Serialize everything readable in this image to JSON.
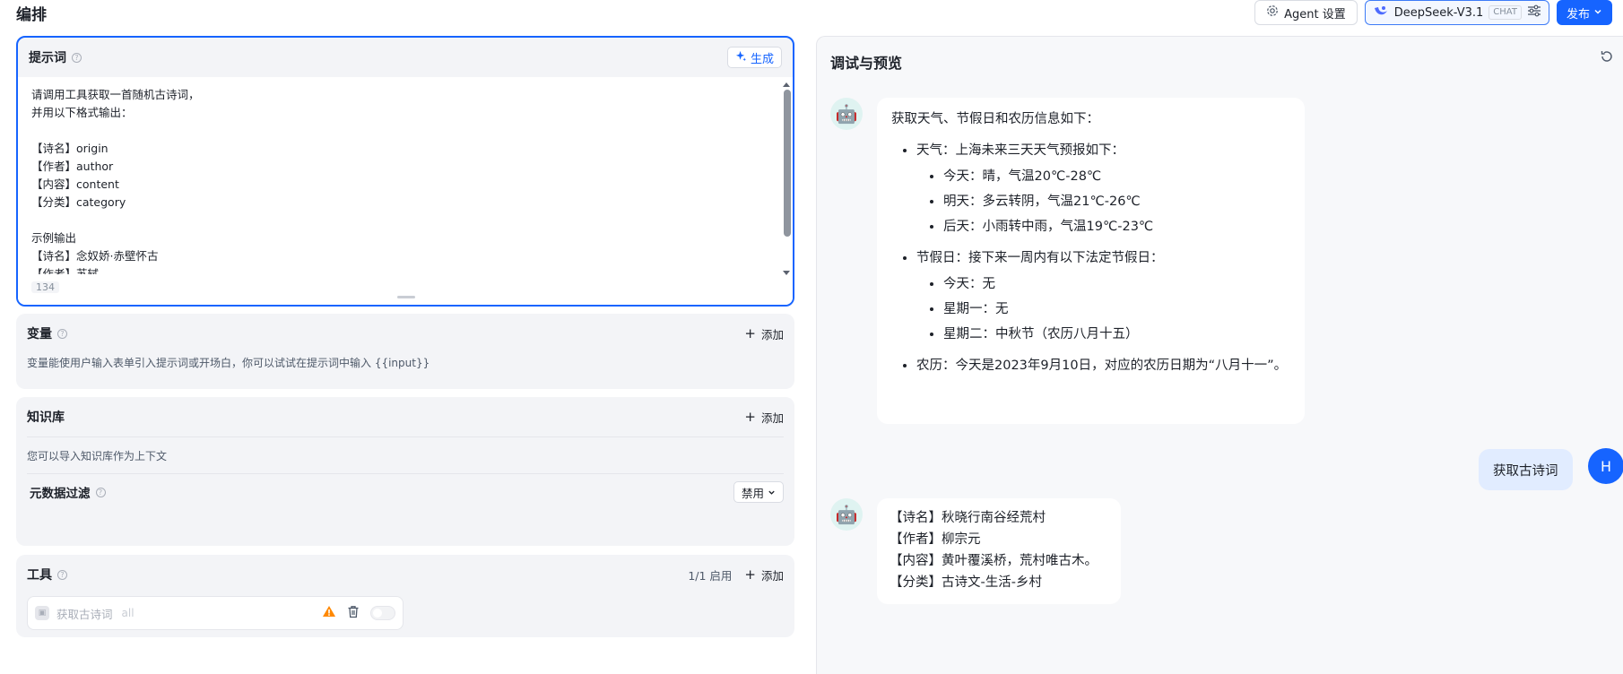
{
  "header": {
    "title": "编排",
    "agent_settings_label": "Agent 设置",
    "model_name": "DeepSeek-V3.1",
    "model_tag": "CHAT",
    "publish_label": "发布"
  },
  "prompt": {
    "title": "提示词",
    "generate_label": "生成",
    "text": "请调用工具获取一首随机古诗词，\n并用以下格式输出：\n\n【诗名】origin\n【作者】author\n【内容】content\n【分类】category\n\n示例输出\n【诗名】念奴娇·赤壁怀古\n【作者】苏轼",
    "char_count": "134"
  },
  "variables": {
    "title": "变量",
    "add_label": "添加",
    "description": "变量能使用户输入表单引入提示词或开场白，你可以试试在提示词中输入 {{input}}"
  },
  "knowledge": {
    "title": "知识库",
    "add_label": "添加",
    "description": "您可以导入知识库作为上下文",
    "metadata_filter_label": "元数据过滤",
    "metadata_filter_value": "禁用"
  },
  "tools": {
    "title": "工具",
    "status": "1/1 启用",
    "add_label": "添加",
    "items": [
      {
        "name": "获取古诗词",
        "sub": "all"
      }
    ]
  },
  "preview": {
    "title": "调试与预览",
    "messages": [
      {
        "role": "assistant",
        "intro": "获取天气、节假日和农历信息如下：",
        "weather_label": "天气：上海未来三天天气预报如下：",
        "weather": [
          "今天：晴，气温20℃-28℃",
          "明天：多云转阴，气温21℃-26℃",
          "后天：小雨转中雨，气温19℃-23℃"
        ],
        "holiday_label": "节假日：接下来一周内有以下法定节假日：",
        "holidays": [
          "今天：无",
          "星期一：无",
          "星期二：中秋节（农历八月十五）"
        ],
        "lunar": "农历：今天是2023年9月10日，对应的农历日期为“八月十一”。"
      },
      {
        "role": "user",
        "text": "获取古诗词",
        "avatar_letter": "H"
      },
      {
        "role": "assistant",
        "lines": [
          "【诗名】秋晓行南谷经荒村",
          "【作者】柳宗元",
          "【内容】黄叶覆溪桥，荒村唯古木。",
          "【分类】古诗文-生活-乡村"
        ]
      }
    ]
  },
  "colors": {
    "primary": "#1664ff",
    "warning": "#ff8800",
    "panel_bg": "#f3f4f7"
  }
}
